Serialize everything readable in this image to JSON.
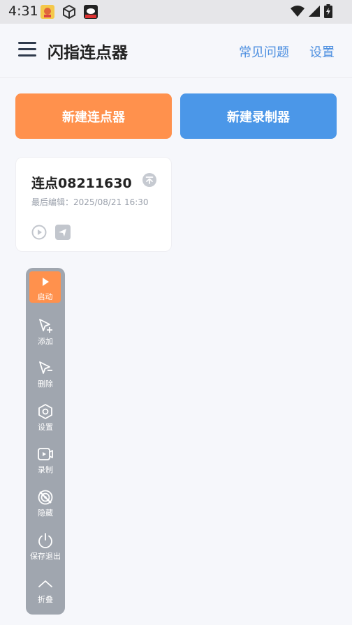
{
  "status": {
    "time": "4:31"
  },
  "appbar": {
    "title": "闪指连点器",
    "faq": "常见问题",
    "settings": "设置"
  },
  "buttons": {
    "new_clicker": "新建连点器",
    "new_recorder": "新建录制器"
  },
  "card": {
    "title": "连点08211630",
    "meta": "最后编辑：2025/08/21 16:30"
  },
  "floatbar": {
    "start": "启动",
    "add": "添加",
    "delete": "删除",
    "settings": "设置",
    "record": "录制",
    "hide": "隐藏",
    "save_exit": "保存退出",
    "collapse": "折叠"
  },
  "colors": {
    "accent_orange": "#ff914d",
    "accent_blue": "#4b97e8",
    "link_blue": "#4d8fe0"
  }
}
